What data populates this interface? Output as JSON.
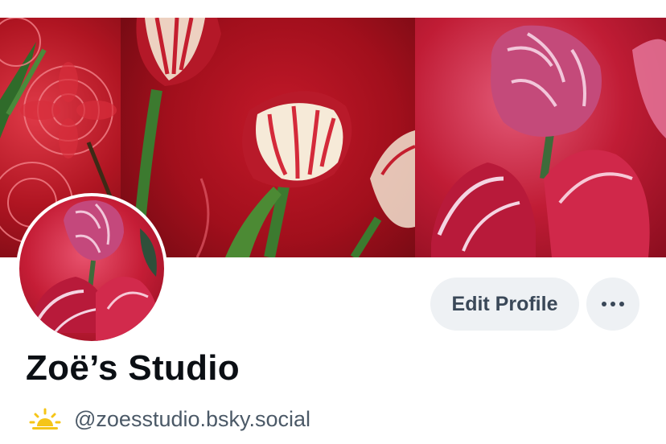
{
  "profile": {
    "display_name": "Zoë’s Studio",
    "handle": "@zoesstudio.bsky.social",
    "handle_icon": "sun-icon"
  },
  "actions": {
    "edit_label": "Edit Profile",
    "more_icon": "more-dots-icon"
  },
  "colors": {
    "button_bg": "#eef1f4",
    "button_text": "#3a4858",
    "name_text": "#0b0f14",
    "handle_text": "#4b5967",
    "sun": "#f5c518"
  }
}
